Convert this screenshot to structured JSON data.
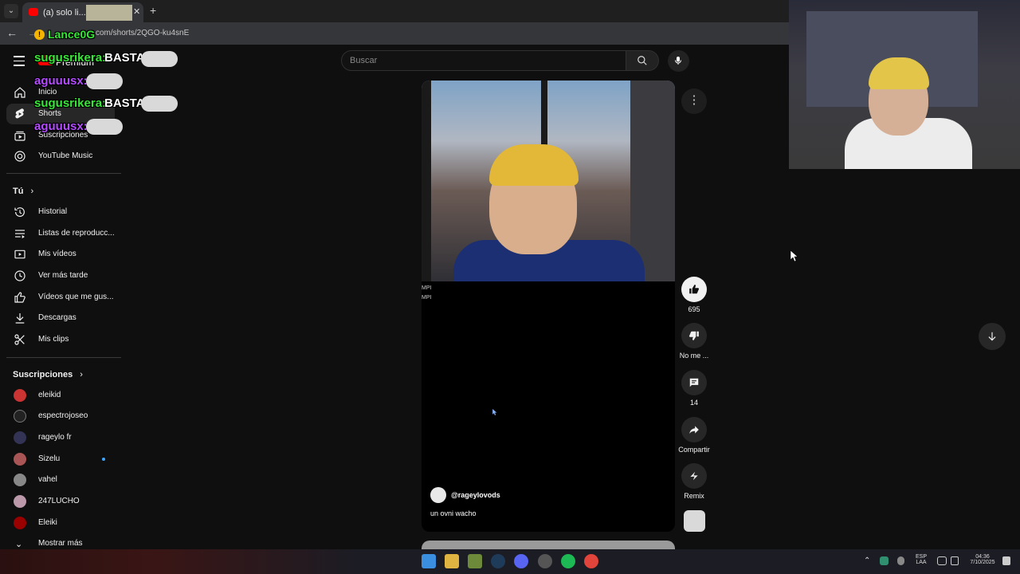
{
  "browser": {
    "tab_title": "(a) solo li...",
    "url": "com/shorts/2QGO-ku4snE"
  },
  "stream_overlay": {
    "donor_name": "Lance0G",
    "chat": [
      {
        "user": "sugusrikera:",
        "message": "BASTA"
      },
      {
        "user": "aguuusx:",
        "message": ""
      },
      {
        "user": "sugusrikera:",
        "message": "BASTA"
      },
      {
        "user": "aguuusx:",
        "message": ""
      }
    ]
  },
  "header": {
    "logo_text": "Premium",
    "search_placeholder": "Buscar"
  },
  "sidebar": {
    "main": [
      {
        "label": "Inicio",
        "icon": "home-icon"
      },
      {
        "label": "Shorts",
        "icon": "shorts-icon",
        "active": true
      },
      {
        "label": "Suscripciones",
        "icon": "subscriptions-icon"
      },
      {
        "label": "YouTube Music",
        "icon": "music-icon"
      }
    ],
    "you_title": "Tú",
    "you": [
      {
        "label": "Historial",
        "icon": "history-icon"
      },
      {
        "label": "Listas de reproducc...",
        "icon": "playlists-icon"
      },
      {
        "label": "Mis vídeos",
        "icon": "my-videos-icon"
      },
      {
        "label": "Ver más tarde",
        "icon": "watch-later-icon"
      },
      {
        "label": "Vídeos que me gus...",
        "icon": "liked-icon"
      },
      {
        "label": "Descargas",
        "icon": "download-icon"
      },
      {
        "label": "Mis clips",
        "icon": "clips-icon"
      }
    ],
    "subs_title": "Suscripciones",
    "subscriptions": [
      {
        "label": "eleikid",
        "color": "#c33"
      },
      {
        "label": "espectrojoseo",
        "color": "#222"
      },
      {
        "label": "rageylo fr",
        "color": "#335"
      },
      {
        "label": "Sizelu",
        "color": "#a55",
        "live": true
      },
      {
        "label": "vahel",
        "color": "#888"
      },
      {
        "label": "247LUCHO",
        "color": "#b9a"
      },
      {
        "label": "Eleiki",
        "color": "#900"
      }
    ],
    "show_more": "Mostrar más"
  },
  "short": {
    "channel": "@rageylovods",
    "caption": "un ovni wacho",
    "mp_labels": [
      "MPI",
      "MPI"
    ],
    "likes": "695",
    "dislike_label": "No me ...",
    "comments": "14",
    "share_label": "Compartir",
    "remix_label": "Remix"
  },
  "taskbar": {
    "lang": "ESP",
    "layout": "LAA",
    "time": "04:36",
    "date": "7/10/2025"
  }
}
